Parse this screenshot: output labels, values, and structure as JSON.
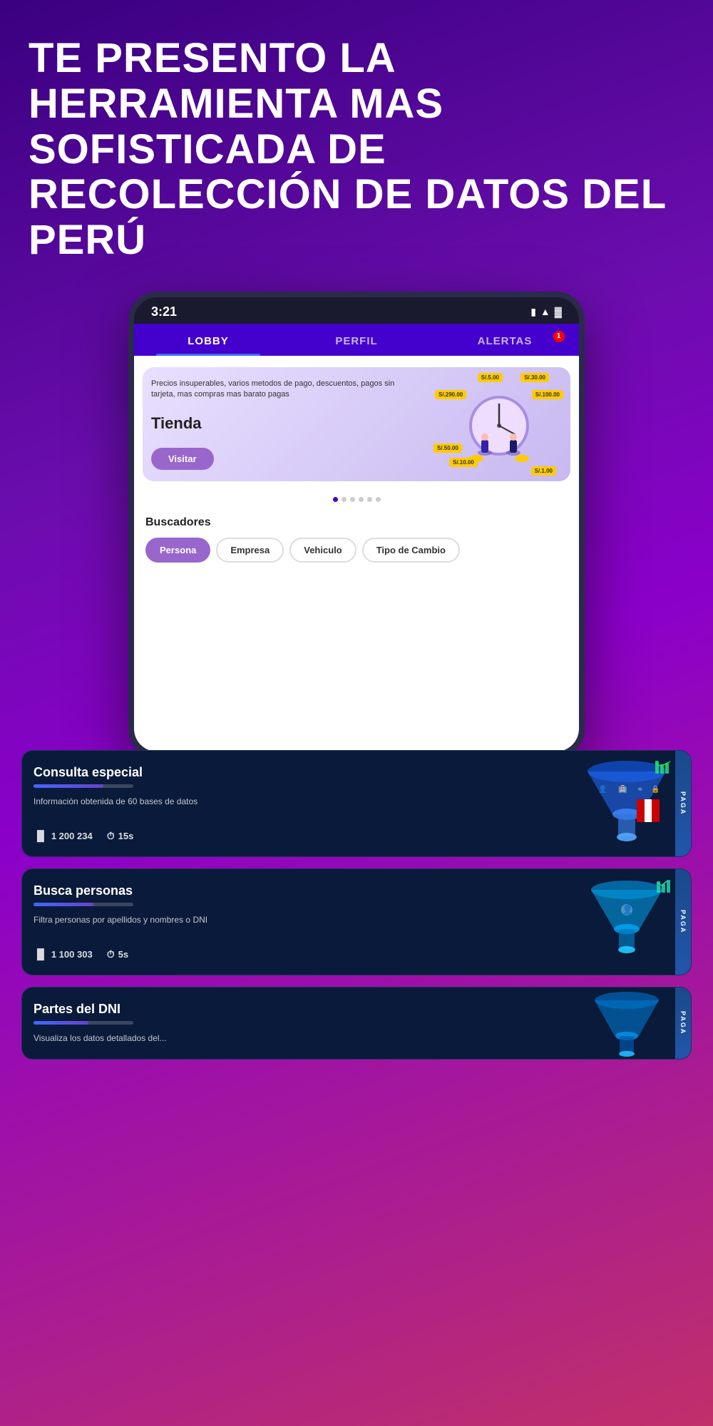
{
  "hero": {
    "title": "TE PRESENTO LA HERRAMIENTA MAS SOFISTICADA DE RECOLECCIÓN DE DATOS DEL PERÚ"
  },
  "phone": {
    "time": "3:21",
    "battery_icon": "🔋",
    "wifi_icon": "▲",
    "tabs": [
      {
        "label": "LOBBY",
        "active": true,
        "badge": null
      },
      {
        "label": "PERFIL",
        "active": false,
        "badge": null
      },
      {
        "label": "ALERTAS",
        "active": false,
        "badge": "1"
      }
    ],
    "banner": {
      "description": "Precios insuperables, varios metodos de pago, descuentos, pagos sin tarjeta, mas compras mas barato pagas",
      "title": "Tienda",
      "button_label": "Visitar"
    },
    "price_tags": [
      "S/.30.00",
      "S/.5.00",
      "S/.290.00",
      "S/.100.00",
      "S/.50.00",
      "S/.10.00",
      "S/.1.00"
    ],
    "search": {
      "title": "Buscadores",
      "filters": [
        {
          "label": "Persona",
          "active": true
        },
        {
          "label": "Empresa",
          "active": false
        },
        {
          "label": "Vehiculo",
          "active": false
        },
        {
          "label": "Tipo de Cambio",
          "active": false
        }
      ]
    }
  },
  "cards": [
    {
      "title": "Consulta especial",
      "description": "Información obtenida de 60 bases de datos",
      "progress_pct": 70,
      "stats": [
        {
          "icon": "bar",
          "value": "1 200 234"
        },
        {
          "icon": "clock",
          "value": "15s"
        }
      ],
      "paga": "PAGA"
    },
    {
      "title": "Busca personas",
      "description": "Filtra personas por apellidos y nombres o DNI",
      "progress_pct": 60,
      "stats": [
        {
          "icon": "bar",
          "value": "1 100 303"
        },
        {
          "icon": "clock",
          "value": "5s"
        }
      ],
      "paga": "PAGA"
    },
    {
      "title": "Partes del DNI",
      "description": "Visualiza los datos detallados del...",
      "progress_pct": 55,
      "stats": [],
      "paga": "PAGA"
    }
  ]
}
